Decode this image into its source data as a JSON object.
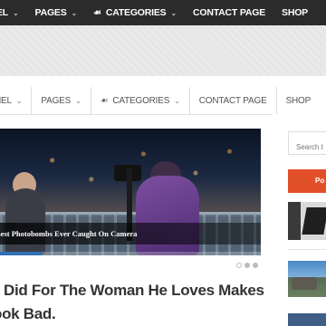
{
  "top_nav": {
    "items": [
      {
        "label": "EL",
        "chevron": true
      },
      {
        "label": "PAGES",
        "chevron": true
      },
      {
        "label": "CATEGORIES",
        "chevron": true,
        "icon": "tag-icon"
      },
      {
        "label": "CONTACT PAGE",
        "chevron": false
      },
      {
        "label": "SHOP",
        "chevron": false
      }
    ]
  },
  "sub_nav": {
    "items": [
      {
        "label": "NEL",
        "chevron": true
      },
      {
        "label": "PAGES",
        "chevron": true
      },
      {
        "label": "CATEGORIES",
        "chevron": true,
        "icon": "tag-icon"
      },
      {
        "label": "CONTACT PAGE",
        "chevron": false
      },
      {
        "label": "SHOP",
        "chevron": false
      }
    ]
  },
  "slider": {
    "caption": "Best Photobombs Ever Caught On Camera",
    "progress": 0.16,
    "slides": 3,
    "active_slide": 1
  },
  "headline": {
    "line1": "Did For The Woman He Loves Makes",
    "line2": "ook Bad."
  },
  "sidebar": {
    "search_placeholder": "Search t",
    "tab_label": "Po"
  },
  "colors": {
    "top_nav_bg": "#2b2b2b",
    "accent": "#e2502a",
    "progress": "#2f6fb3"
  }
}
